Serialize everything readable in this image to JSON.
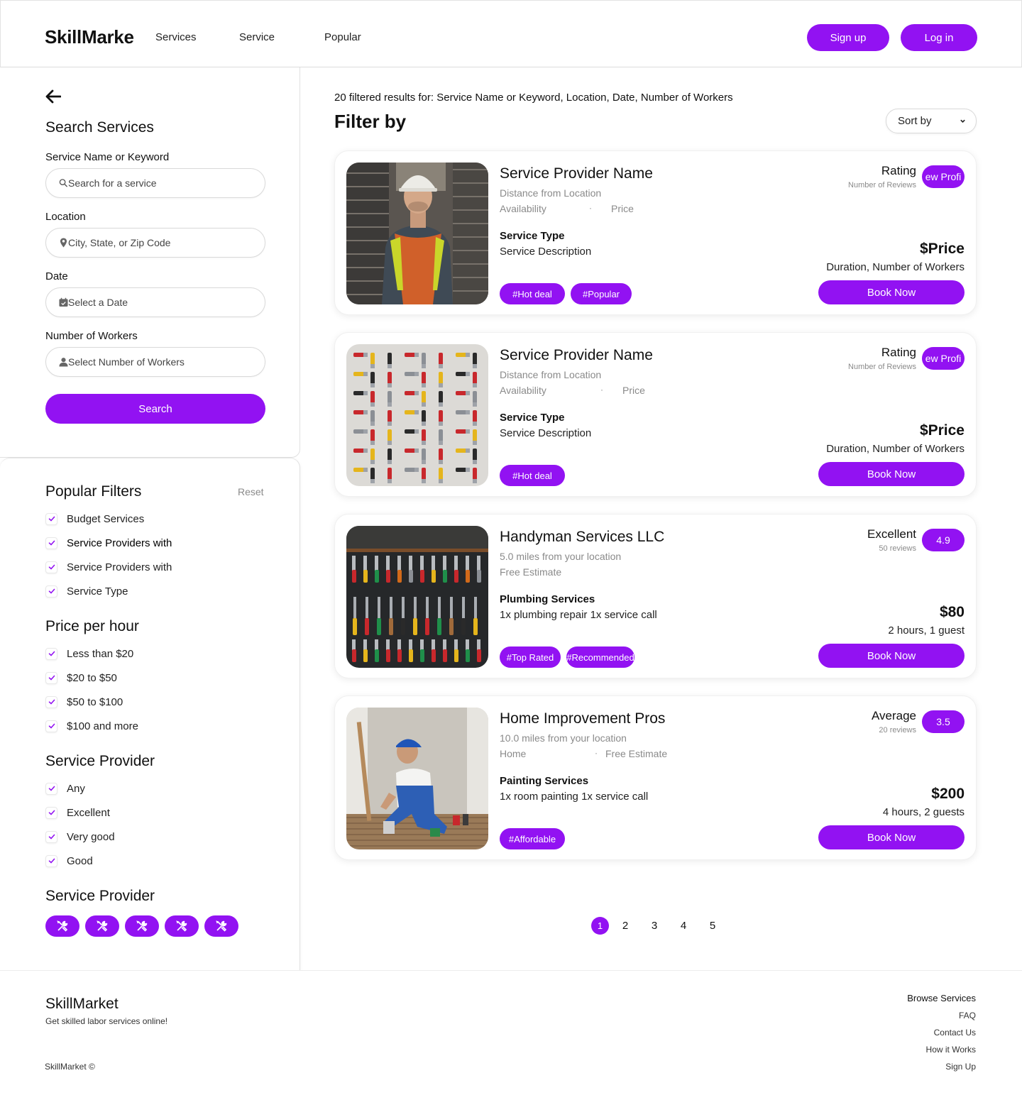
{
  "header": {
    "logo": "SkillMarke",
    "nav": [
      "Services",
      "Service",
      "Popular"
    ],
    "signup_label": "Sign up",
    "login_label": "Log in"
  },
  "search": {
    "title": "Search Services",
    "keyword_label": "Service Name or Keyword",
    "keyword_placeholder": "Search for a service",
    "location_label": "Location",
    "location_placeholder": "City, State, or Zip Code",
    "date_label": "Date",
    "date_placeholder": "Select a Date",
    "workers_label": "Number of Workers",
    "workers_placeholder": "Select Number of Workers",
    "search_label": "Search"
  },
  "filters": {
    "popular_title": "Popular Filters",
    "reset_label": "Reset",
    "popular": [
      "Budget Services",
      "Service Providers with",
      "Service Providers with",
      "Service Type"
    ],
    "price_title": "Price per hour",
    "price": [
      "Less than $20",
      "$20 to $50",
      "$50 to $100",
      "$100 and more"
    ],
    "provider_title": "Service Provider",
    "provider": [
      "Any",
      "Excellent",
      "Very good",
      "Good"
    ],
    "provider2_title": "Service Provider",
    "tool_icons": [
      "tools-icon",
      "tools-icon",
      "tools-icon",
      "tools-icon",
      "tools-icon"
    ]
  },
  "main": {
    "result_summary": "20 filtered results for: Service Name or Keyword, Location, Date, Number of Workers",
    "filter_title": "Filter by",
    "sort_label": "Sort by",
    "book_label": "Book Now",
    "cards": [
      {
        "name": "Service Provider Name",
        "meta1": "Distance from Location",
        "meta2a": "Availability",
        "meta2b": "Price",
        "type": "Service Type",
        "desc": "Service Description",
        "tags": [
          "#Hot deal",
          "#Popular"
        ],
        "rating": "Rating",
        "reviews": "Number of Reviews",
        "score": "ew Profi",
        "price": "$Price",
        "duration": "Duration, Number of Workers",
        "image": "worker-in-hardhat-photo"
      },
      {
        "name": "Service Provider Name",
        "meta1": "Distance from Location",
        "meta2a": "Availability",
        "meta2b": "Price",
        "type": "Service Type",
        "desc": "Service Description",
        "tags": [
          "#Hot deal"
        ],
        "rating": "Rating",
        "reviews": "Number of Reviews",
        "score": "ew Profi",
        "price": "$Price",
        "duration": "Duration, Number of Workers",
        "image": "tools-flatlay-photo"
      },
      {
        "name": "Handyman Services LLC",
        "meta1": "5.0 miles from your location",
        "meta2a": "Free Estimate",
        "meta2b": "",
        "type": "Plumbing Services",
        "desc": "1x plumbing repair 1x service call",
        "tags": [
          "#Top Rated",
          "#Recommended"
        ],
        "rating": "Excellent",
        "reviews": "50 reviews",
        "score": "4.9",
        "price": "$80",
        "duration": "2 hours, 1 guest",
        "image": "tool-wall-photo"
      },
      {
        "name": "Home Improvement Pros",
        "meta1": "10.0 miles from your location",
        "meta2a": "Home",
        "meta2b": "Free Estimate",
        "type": "Painting Services",
        "desc": "1x room painting 1x service call",
        "tags": [
          "#Affordable"
        ],
        "rating": "Average",
        "reviews": "20 reviews",
        "score": "3.5",
        "price": "$200",
        "duration": "4 hours, 2 guests",
        "image": "painter-kneeling-photo"
      }
    ]
  },
  "pagination": {
    "pages": [
      "1",
      "2",
      "3",
      "4",
      "5"
    ],
    "current": "1"
  },
  "footer": {
    "brand": "SkillMarket",
    "tagline": "Get skilled labor services online!",
    "copyright": "SkillMarket ©",
    "links": [
      "Browse Services",
      "FAQ",
      "Contact Us",
      "How it Works",
      "Sign Up"
    ]
  },
  "colors": {
    "accent": "#9212f2",
    "muted_text": "#8a8a8a"
  }
}
